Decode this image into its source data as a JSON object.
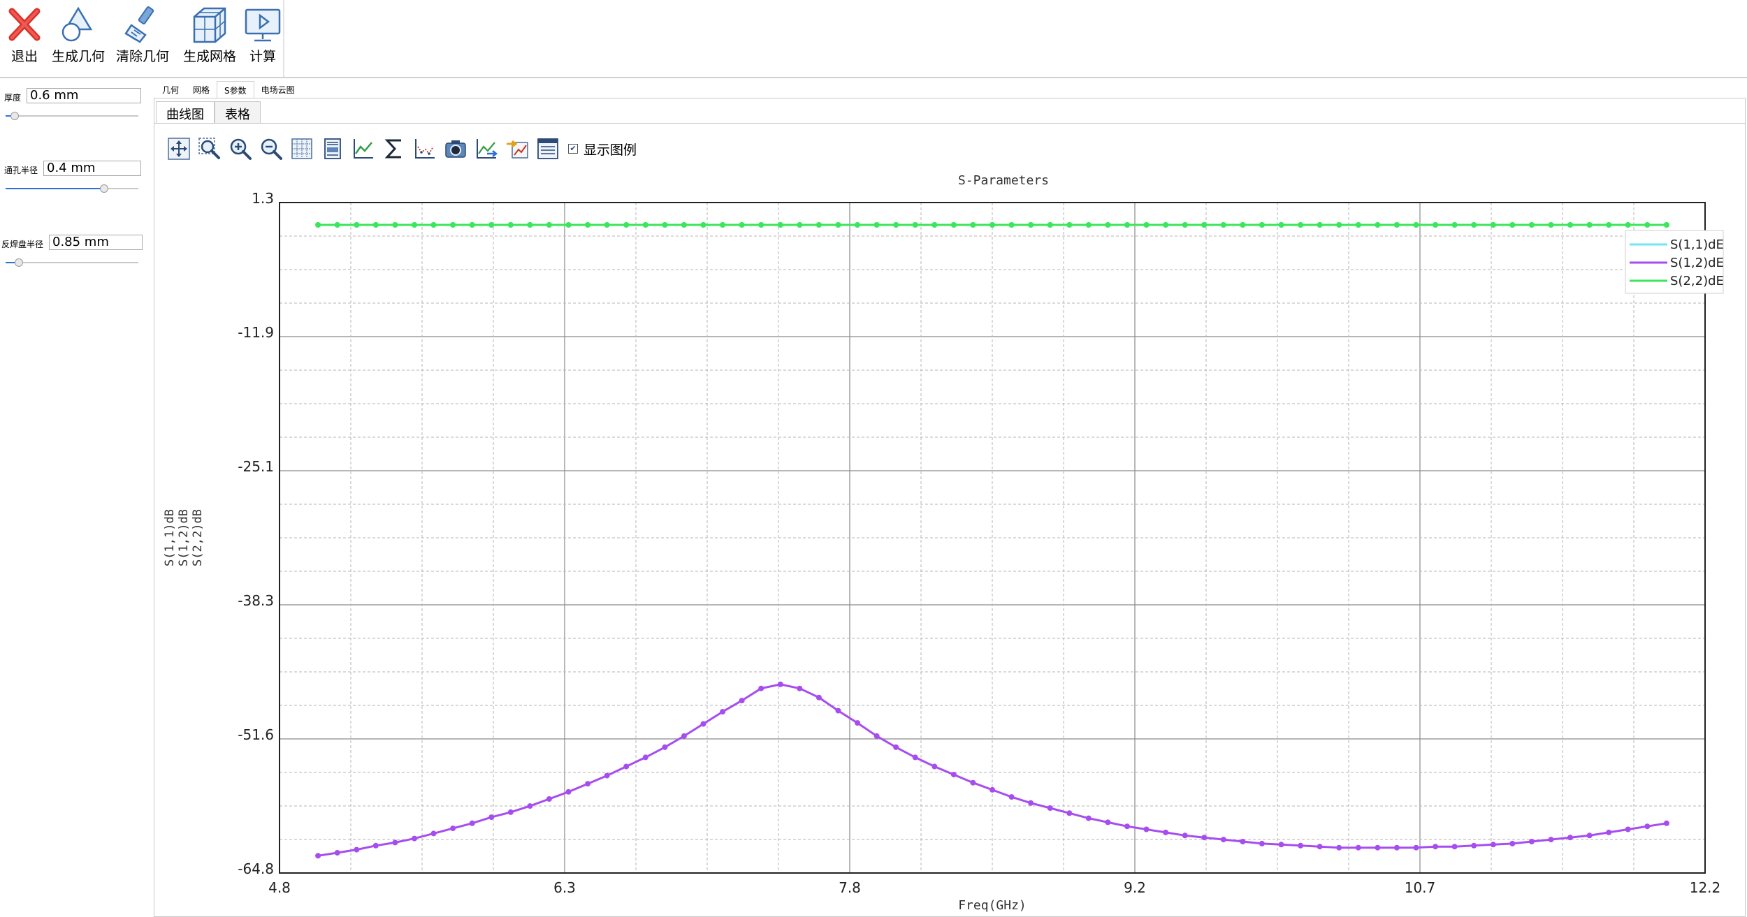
{
  "ribbon": {
    "buttons": [
      {
        "label": "退出",
        "icon": "exit-icon"
      },
      {
        "label": "生成几何",
        "icon": "shape-icon"
      },
      {
        "label": "清除几何",
        "icon": "brush-icon"
      },
      {
        "label": "生成网格",
        "icon": "mesh-cube-icon"
      },
      {
        "label": "计算",
        "icon": "monitor-play-icon"
      }
    ]
  },
  "params": [
    {
      "label": "厚度",
      "value": "0.6 mm",
      "slider": 0.07
    },
    {
      "label": "通孔半径",
      "value": "0.4 mm",
      "slider": 0.74
    },
    {
      "label": "反焊盘半径",
      "value": "0.85 mm",
      "slider": 0.1
    }
  ],
  "main_tabs": [
    "几何",
    "网格",
    "S参数",
    "电场云图"
  ],
  "main_tab_active": 2,
  "sub_tabs": [
    "曲线图",
    "表格"
  ],
  "sub_tab_active": 0,
  "plot_toolbar": {
    "icons": [
      "pan-icon",
      "zoom-box-icon",
      "zoom-in-icon",
      "zoom-out-icon",
      "grid-icon",
      "print-icon",
      "line-chart-icon",
      "sum-icon",
      "scatter-icon",
      "camera-icon",
      "export-chart-icon",
      "import-chart-icon",
      "properties-icon"
    ],
    "legend_label": "显示图例",
    "legend_checked": true
  },
  "chart_data": {
    "type": "line",
    "title": "S-Parameters",
    "xlabel": "Freq(GHz)",
    "ylabels": [
      "S(1,1)dB",
      "S(1,2)dB",
      "S(2,2)dB"
    ],
    "xlim": [
      4.8,
      12.2
    ],
    "ylim": [
      -64.8,
      1.3
    ],
    "xticks": [
      "4.8",
      "6.3",
      "7.8",
      "9.2",
      "10.7",
      "12.2"
    ],
    "yticks": [
      "1.3",
      "-11.9",
      "-25.1",
      "-38.3",
      "-51.6",
      "-64.8"
    ],
    "grid": true,
    "legend_position": "top-right",
    "x_start": 5.0,
    "x_step": 0.1,
    "series": [
      {
        "name": "S(1,1)dE",
        "color": "#6fe8ef",
        "values": [
          -0.9,
          -0.9,
          -0.9,
          -0.9,
          -0.9,
          -0.9,
          -0.9,
          -0.9,
          -0.9,
          -0.9,
          -0.9,
          -0.9,
          -0.9,
          -0.9,
          -0.9,
          -0.9,
          -0.9,
          -0.9,
          -0.9,
          -0.9,
          -0.9,
          -0.9,
          -0.9,
          -0.9,
          -0.9,
          -0.9,
          -0.9,
          -0.9,
          -0.9,
          -0.9,
          -0.9,
          -0.9,
          -0.9,
          -0.9,
          -0.9,
          -0.9,
          -0.9,
          -0.9,
          -0.9,
          -0.9,
          -0.9,
          -0.9,
          -0.9,
          -0.9,
          -0.9,
          -0.9,
          -0.9,
          -0.9,
          -0.9,
          -0.9,
          -0.9,
          -0.9,
          -0.9,
          -0.9,
          -0.9,
          -0.9,
          -0.9,
          -0.9,
          -0.9,
          -0.9,
          -0.9,
          -0.9,
          -0.9,
          -0.9,
          -0.9,
          -0.9,
          -0.9,
          -0.9,
          -0.9,
          -0.9,
          -0.9
        ]
      },
      {
        "name": "S(1,2)dE",
        "color": "#a64df0",
        "values": [
          -63.1,
          -62.8,
          -62.5,
          -62.1,
          -61.8,
          -61.4,
          -60.9,
          -60.4,
          -59.9,
          -59.3,
          -58.8,
          -58.2,
          -57.5,
          -56.8,
          -56.0,
          -55.2,
          -54.3,
          -53.4,
          -52.4,
          -51.3,
          -50.1,
          -48.9,
          -47.8,
          -46.6,
          -46.2,
          -46.6,
          -47.5,
          -48.8,
          -50.0,
          -51.3,
          -52.4,
          -53.4,
          -54.3,
          -55.1,
          -55.9,
          -56.6,
          -57.3,
          -57.9,
          -58.4,
          -58.9,
          -59.4,
          -59.8,
          -60.2,
          -60.5,
          -60.8,
          -61.1,
          -61.3,
          -61.5,
          -61.7,
          -61.9,
          -62.0,
          -62.1,
          -62.2,
          -62.3,
          -62.3,
          -62.3,
          -62.3,
          -62.3,
          -62.2,
          -62.2,
          -62.1,
          -62.0,
          -61.9,
          -61.7,
          -61.5,
          -61.3,
          -61.1,
          -60.8,
          -60.5,
          -60.2,
          -59.9
        ]
      },
      {
        "name": "S(2,2)dE",
        "color": "#3be65a",
        "values": [
          -0.9,
          -0.9,
          -0.9,
          -0.9,
          -0.9,
          -0.9,
          -0.9,
          -0.9,
          -0.9,
          -0.9,
          -0.9,
          -0.9,
          -0.9,
          -0.9,
          -0.9,
          -0.9,
          -0.9,
          -0.9,
          -0.9,
          -0.9,
          -0.9,
          -0.9,
          -0.9,
          -0.9,
          -0.9,
          -0.9,
          -0.9,
          -0.9,
          -0.9,
          -0.9,
          -0.9,
          -0.9,
          -0.9,
          -0.9,
          -0.9,
          -0.9,
          -0.9,
          -0.9,
          -0.9,
          -0.9,
          -0.9,
          -0.9,
          -0.9,
          -0.9,
          -0.9,
          -0.9,
          -0.9,
          -0.9,
          -0.9,
          -0.9,
          -0.9,
          -0.9,
          -0.9,
          -0.9,
          -0.9,
          -0.9,
          -0.9,
          -0.9,
          -0.9,
          -0.9,
          -0.9,
          -0.9,
          -0.9,
          -0.9,
          -0.9,
          -0.9,
          -0.9,
          -0.9,
          -0.9,
          -0.9,
          -0.9
        ]
      }
    ]
  }
}
